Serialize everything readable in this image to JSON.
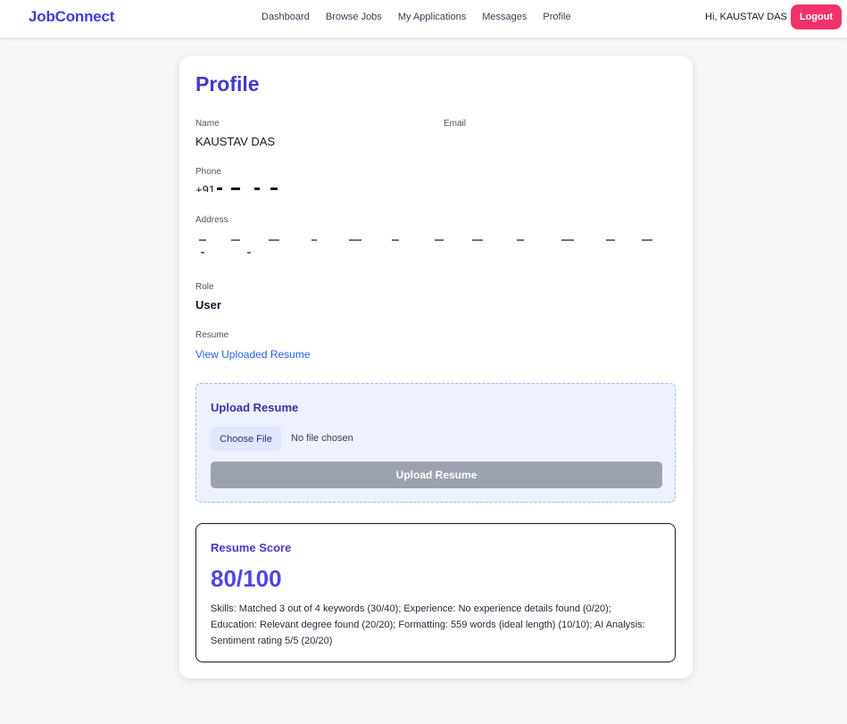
{
  "nav": {
    "brand": "JobConnect",
    "links": [
      "Dashboard",
      "Browse Jobs",
      "My Applications",
      "Messages",
      "Profile"
    ],
    "greeting": "Hi, KAUSTAV DAS",
    "logout_label": "Logout"
  },
  "profile": {
    "title": "Profile",
    "name_label": "Name",
    "name_value": "KAUSTAV DAS",
    "email_label": "Email",
    "phone_label": "Phone",
    "phone_value_prefix": "+91",
    "address_label": "Address",
    "role_label": "Role",
    "role_value": "User",
    "resume_label": "Resume",
    "resume_link": "View Uploaded Resume"
  },
  "upload": {
    "title": "Upload Resume",
    "choose_label": "Choose File",
    "no_file_text": "No file chosen",
    "button_label": "Upload Resume"
  },
  "score": {
    "title": "Resume Score",
    "value": "80/100",
    "details": "Skills: Matched 3 out of 4 keywords (30/40); Experience: No experience details found (0/20); Education: Relevant degree found (20/20); Formatting: 559 words (ideal length) (10/10); AI Analysis: Sentiment rating 5/5 (20/20)"
  },
  "colors": {
    "brand": "#3b3fd8",
    "accent": "#4338ca",
    "logout": "#f0336a",
    "link": "#2563eb",
    "disabled_button": "#9ca3af"
  }
}
